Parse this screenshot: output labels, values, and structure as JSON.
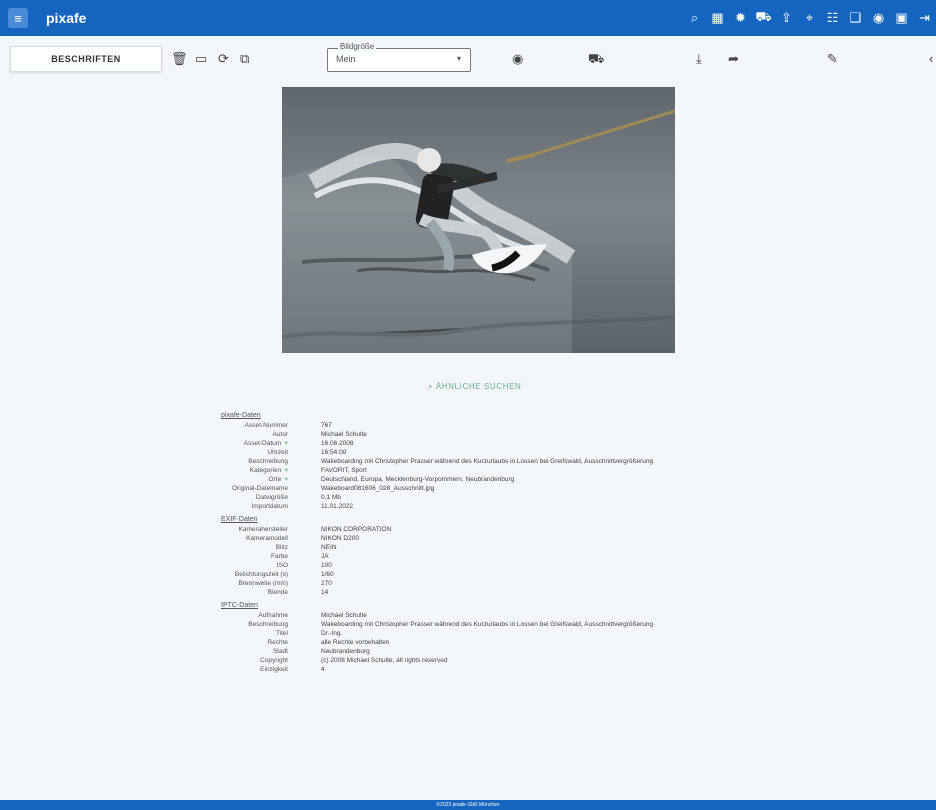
{
  "app": {
    "title": "pixafe",
    "menu_icon": "hamburger-menu-icon"
  },
  "header": {
    "icons": [
      "search-icon",
      "dashboard-icon",
      "gear-icon",
      "cart-icon",
      "upload-icon",
      "map-pin-icon",
      "users-icon",
      "collections-icon",
      "public-icon",
      "media-icon",
      "logout-icon"
    ]
  },
  "toolbar": {
    "caption_button": "BESCHRIFTEN",
    "buttons": [
      "delete-icon",
      "save-icon",
      "sync-icon",
      "copy-icon"
    ],
    "select": {
      "legend": "Bildgröße",
      "value": "Mein"
    },
    "view_icon": "eye-icon",
    "cart_icon": "cart-add-icon",
    "download_icon": "download-icon",
    "share_icon": "share-icon",
    "edit_icon": "edit-icon"
  },
  "find_similar": {
    "icon": "image-search-icon",
    "label": "ÄHNLICHE SUCHEN"
  },
  "metadata": {
    "sections": [
      {
        "title": "pixafe-Daten",
        "rows": [
          {
            "label": "Asset-Nummer",
            "value": "767"
          },
          {
            "label": "Autor",
            "value": "Michael Schulte"
          },
          {
            "label": "Asset-Datum",
            "plus": true,
            "value": "16.06.2008"
          },
          {
            "label": "Uhrzeit",
            "value": "16:54:00"
          },
          {
            "label": "Beschreibung",
            "value": "Wakeboarding mit Christopher Prasser während des Kurzurlaubs in Lossen bei Greifswald, Ausschnittvergrößerung"
          },
          {
            "label": "Kategorien",
            "plus": true,
            "value": "FAVORIT, Sport"
          },
          {
            "label": "Orte",
            "plus": true,
            "value": "Deutschland, Europa, Mecklenburg-Vorpommern, Neubrandenburg"
          },
          {
            "label": "Original-Dateiname",
            "value": "Wakeboard081606_028_Ausschnitt.jpg"
          },
          {
            "label": "Dateigröße",
            "value": "0,1 Mb"
          },
          {
            "label": "Importdatum",
            "value": "11.01.2022"
          }
        ]
      },
      {
        "title": "EXIF-Daten",
        "rows": [
          {
            "label": "Kamerahersteller",
            "value": "NIKON CORPORATION"
          },
          {
            "label": "Kameramodell",
            "value": "NIKON D200"
          },
          {
            "label": "Blitz",
            "value": "NEIN"
          },
          {
            "label": "Farbe",
            "value": "JA"
          },
          {
            "label": "ISO",
            "value": "100"
          },
          {
            "label": "Belichtungszeit (s)",
            "value": "1/60"
          },
          {
            "label": "Brennweite (mm)",
            "value": "270"
          },
          {
            "label": "Blende",
            "value": "14"
          }
        ]
      },
      {
        "title": "IPTC-Daten",
        "rows": [
          {
            "label": "Aufnahme",
            "value": "Michael Schulte"
          },
          {
            "label": "Beschreibung",
            "value": "Wakeboarding mit Christopher Prasser während des Kurzurlaubs in Lossen bei Greifswald, Ausschnittvergrößerung"
          },
          {
            "label": "Titel",
            "value": "Dr.-Ing."
          },
          {
            "label": "Rechte",
            "value": "alle Rechte vorbehalten"
          },
          {
            "label": "Stadt",
            "value": "Neubrandenburg"
          },
          {
            "label": "Copyright",
            "value": "(c) 2008 Michael Schulte, all rights reserved"
          },
          {
            "label": "Einzigkeit",
            "value": "4"
          }
        ]
      }
    ]
  },
  "footer": {
    "text": "©2023 pixafe GbR München"
  }
}
